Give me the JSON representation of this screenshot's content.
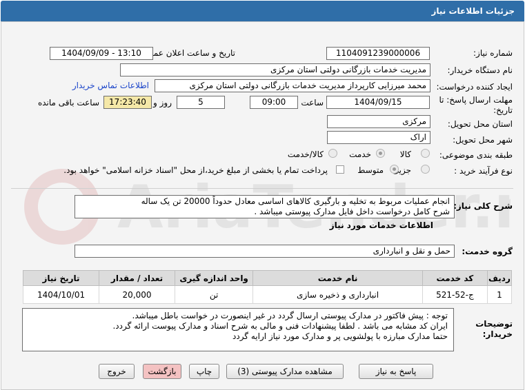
{
  "header": {
    "title": "جزئیات اطلاعات نیاز"
  },
  "form": {
    "need_number_label": "شماره نیاز:",
    "need_number": "1104091239000006",
    "announce_label": "تاریخ و ساعت اعلان عمومی:",
    "announce_value": "1404/09/09 - 13:10",
    "buyer_org_label": "نام دستگاه خریدار:",
    "buyer_org": "مدیریت خدمات بازرگانی دولتی استان مرکزی",
    "requester_label": "ایجاد کننده درخواست:",
    "requester": "محمد میرزایی کارپرداز مدیریت خدمات بازرگانی دولتی استان مرکزی",
    "contact_link": "اطلاعات تماس خریدار",
    "deadline_label_1": "مهلت ارسال پاسخ: تا",
    "deadline_label_2": "تاریخ:",
    "deadline_date": "1404/09/15",
    "time_label": "ساعت",
    "deadline_time": "09:00",
    "days": "5",
    "days_label": "روز و",
    "remaining_time": "17:23:40",
    "remaining_label": "ساعت باقی مانده",
    "province_label": "استان محل تحویل:",
    "province": "مرکزی",
    "city_label": "شهر محل تحویل:",
    "city": "اراک",
    "category_label": "طبقه بندی موضوعی:",
    "category_options": [
      "کالا",
      "خدمت",
      "کالا/خدمت"
    ],
    "category_selected": "خدمت",
    "process_label": "نوع فرآیند خرید :",
    "process_options": [
      "جزیی",
      "متوسط"
    ],
    "process_selected": "جزیی",
    "payment_note": "پرداخت تمام یا بخشی از مبلغ خرید،از محل \"اسناد خزانه اسلامی\" خواهد بود."
  },
  "description": {
    "label": "شرح کلی نیاز:",
    "line1": "انجام عملیات مربوط به تخلیه و بارگیری کالاهای  اساسی معادل حدوداً 20000 تن یک ساله",
    "line2": "شرح کامل درخواست داخل فایل مدارک پیوستی میباشد ."
  },
  "services_title": "اطلاعات خدمات مورد نیاز",
  "service_group": {
    "label": "گروه خدمت:",
    "value": "حمل و نقل و انبارداری"
  },
  "table": {
    "headers": [
      "ردیف",
      "کد خدمت",
      "نام خدمت",
      "واحد اندازه گیری",
      "تعداد / مقدار",
      "تاریخ نیاز"
    ],
    "rows": [
      [
        "1",
        "ج-52-521",
        "انبارداری و ذخیره سازی",
        "تن",
        "20,000",
        "1404/10/01"
      ]
    ]
  },
  "buyer_notes": {
    "label_1": "توضیحات",
    "label_2": "خریدار:",
    "line1": "توجه : پیش فاکتور در مدارک پیوستی ارسال گردد در غیر اینصورت در خواست باطل میباشد.",
    "line2": "ایران کد مشابه می باشد . لطفا پیشنهادات فنی و مالی به شرح اسناد و مدارک پیوست ارائه گردد.",
    "line3": "حتما مدارک مبارزه با پولشویی پر و مدارک مورد نیاز ارایه گردد"
  },
  "buttons": {
    "reply": "پاسخ به نیاز",
    "view_docs": "مشاهده مدارک پیوستی (3)",
    "print": "چاپ",
    "back": "بازگشت",
    "exit": "خروج"
  },
  "watermark": {
    "text": "AriaTender.net"
  },
  "colors": {
    "header_bg": "#2f6ea8",
    "remaining_bg": "#f5e8a8",
    "back_bg": "#f4c2c2",
    "link": "#1a44c9"
  }
}
